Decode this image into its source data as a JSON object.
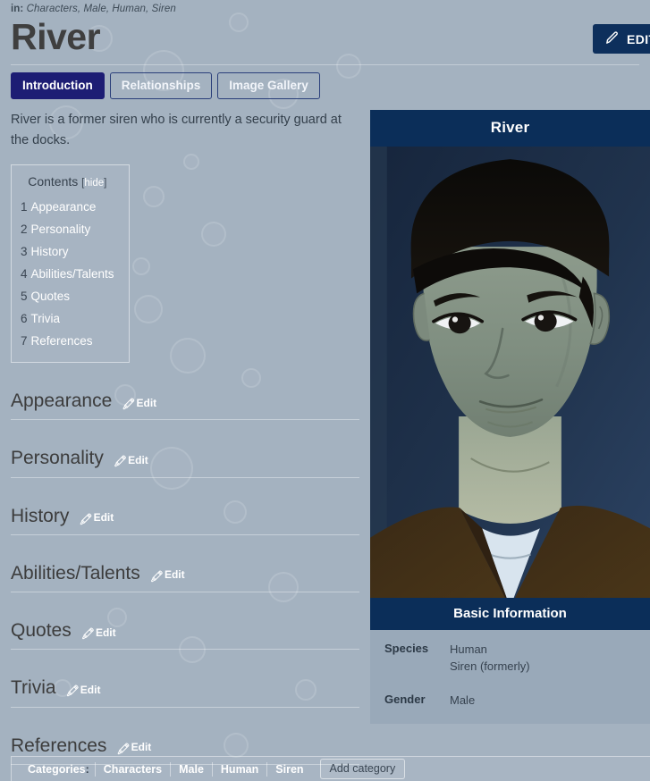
{
  "breadcrumb": {
    "prefix": "in:",
    "categories": "Characters, Male, Human, Siren"
  },
  "header": {
    "title": "River",
    "edit_button_label": "EDIT",
    "edit_icon": "pencil-icon"
  },
  "tabs": [
    {
      "label": "Introduction",
      "active": true
    },
    {
      "label": "Relationships",
      "active": false
    },
    {
      "label": "Image Gallery",
      "active": false
    }
  ],
  "main": {
    "intro_text": "River is a former siren who is currently a security guard at the docks.",
    "toc": {
      "heading": "Contents",
      "hide_bracket_open": "[",
      "hide_label": "hide",
      "hide_bracket_close": "]",
      "items": [
        {
          "num": "1",
          "label": "Appearance"
        },
        {
          "num": "2",
          "label": "Personality"
        },
        {
          "num": "3",
          "label": "History"
        },
        {
          "num": "4",
          "label": "Abilities/Talents"
        },
        {
          "num": "5",
          "label": "Quotes"
        },
        {
          "num": "6",
          "label": "Trivia"
        },
        {
          "num": "7",
          "label": "References"
        }
      ]
    },
    "sections": [
      {
        "title": "Appearance",
        "edit_label": "Edit",
        "edit_icon": "pencil-icon"
      },
      {
        "title": "Personality",
        "edit_label": "Edit",
        "edit_icon": "pencil-icon"
      },
      {
        "title": "History",
        "edit_label": "Edit",
        "edit_icon": "pencil-icon"
      },
      {
        "title": "Abilities/Talents",
        "edit_label": "Edit",
        "edit_icon": "pencil-icon"
      },
      {
        "title": "Quotes",
        "edit_label": "Edit",
        "edit_icon": "pencil-icon"
      },
      {
        "title": "Trivia",
        "edit_label": "Edit",
        "edit_icon": "pencil-icon"
      },
      {
        "title": "References",
        "edit_label": "Edit",
        "edit_icon": "pencil-icon"
      }
    ]
  },
  "infobox": {
    "title": "River",
    "portrait_alt": "character-portrait",
    "basic_information_heading": "Basic Information",
    "rows": [
      {
        "label": "Species",
        "values": [
          "Human",
          "Siren (formerly)"
        ]
      },
      {
        "label": "Gender",
        "values": [
          "Male"
        ]
      }
    ]
  },
  "footer": {
    "categories_label": "Categories",
    "colon": ":",
    "items": [
      "Characters",
      "Male",
      "Human",
      "Siren"
    ],
    "add_category_label": "Add category"
  },
  "colors": {
    "page_background": "#a4b2c0",
    "infobox_header": "#0b2e59",
    "infobox_body": "#99a9b9",
    "active_tab": "#1d1d74",
    "edit_button": "#0d2f5c",
    "heading_text": "#3c3c3c",
    "link_text": "#ffffff"
  }
}
